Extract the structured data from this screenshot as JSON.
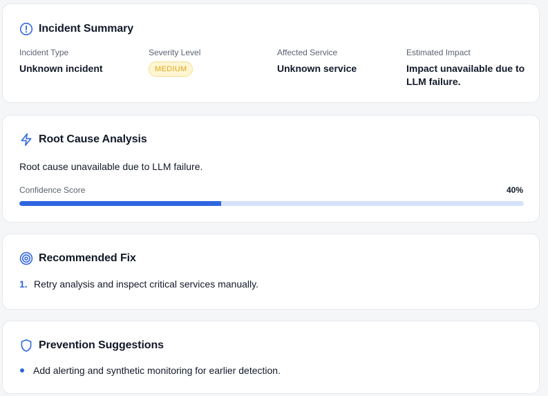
{
  "summary": {
    "title": "Incident Summary",
    "icon": "alert-circle-icon",
    "fields": [
      {
        "label": "Incident Type",
        "value": "Unknown incident"
      },
      {
        "label": "Severity Level",
        "value": "MEDIUM"
      },
      {
        "label": "Affected Service",
        "value": "Unknown service"
      },
      {
        "label": "Estimated Impact",
        "value": "Impact unavailable due to LLM failure."
      }
    ]
  },
  "root_cause": {
    "title": "Root Cause Analysis",
    "icon": "lightning-icon",
    "text": "Root cause unavailable due to LLM failure.",
    "confidence_label": "Confidence Score",
    "confidence_display": "40%",
    "confidence_fraction": 0.4
  },
  "fix": {
    "title": "Recommended Fix",
    "icon": "target-icon",
    "items": [
      {
        "number": "1.",
        "text": "Retry analysis and inspect critical services manually."
      }
    ]
  },
  "prevention": {
    "title": "Prevention Suggestions",
    "icon": "shield-icon",
    "items": [
      {
        "text": "Add alerting and synthetic monitoring for earlier detection."
      }
    ]
  },
  "colors": {
    "accent": "#2f66e0",
    "badge_bg": "#fef6d3",
    "badge_text": "#e0a51a"
  }
}
